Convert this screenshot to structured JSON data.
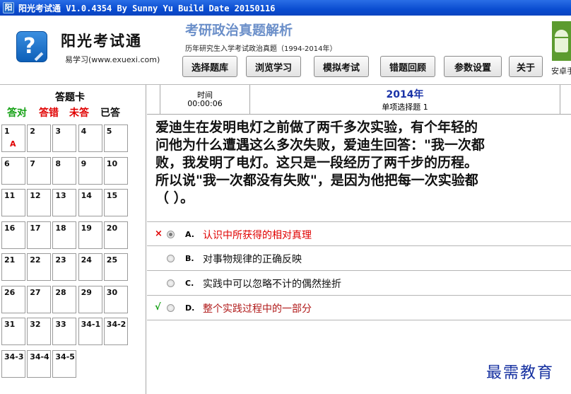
{
  "window": {
    "title": "阳光考试通 V1.0.4354 By Sunny Yu  Build Date 20150116",
    "icon": "阳"
  },
  "header": {
    "app_name": "阳光考试通",
    "app_site": "易学习(www.exuexi.com)",
    "exam_title": "考研政治真题解析",
    "exam_subtitle": "历年研究生入学考试政治真题（1994-2014年）",
    "android_label": "安卓手"
  },
  "nav": [
    "选择题库",
    "浏览学习",
    "模拟考试",
    "错题回顾",
    "参数设置",
    "关于"
  ],
  "answer_card": {
    "title": "答题卡",
    "legend": [
      {
        "label": "答对",
        "color": "#12a012"
      },
      {
        "label": "答错",
        "color": "#e00000"
      },
      {
        "label": "未答",
        "color": "#e00000"
      },
      {
        "label": "已答",
        "color": "#111111"
      }
    ],
    "cells": [
      {
        "n": "1",
        "a": "A"
      },
      {
        "n": "2",
        "a": ""
      },
      {
        "n": "3",
        "a": ""
      },
      {
        "n": "4",
        "a": ""
      },
      {
        "n": "5",
        "a": ""
      },
      {
        "n": "6",
        "a": ""
      },
      {
        "n": "7",
        "a": ""
      },
      {
        "n": "8",
        "a": ""
      },
      {
        "n": "9",
        "a": ""
      },
      {
        "n": "10",
        "a": ""
      },
      {
        "n": "11",
        "a": ""
      },
      {
        "n": "12",
        "a": ""
      },
      {
        "n": "13",
        "a": ""
      },
      {
        "n": "14",
        "a": ""
      },
      {
        "n": "15",
        "a": ""
      },
      {
        "n": "16",
        "a": ""
      },
      {
        "n": "17",
        "a": ""
      },
      {
        "n": "18",
        "a": ""
      },
      {
        "n": "19",
        "a": ""
      },
      {
        "n": "20",
        "a": ""
      },
      {
        "n": "21",
        "a": ""
      },
      {
        "n": "22",
        "a": ""
      },
      {
        "n": "23",
        "a": ""
      },
      {
        "n": "24",
        "a": ""
      },
      {
        "n": "25",
        "a": ""
      },
      {
        "n": "26",
        "a": ""
      },
      {
        "n": "27",
        "a": ""
      },
      {
        "n": "28",
        "a": ""
      },
      {
        "n": "29",
        "a": ""
      },
      {
        "n": "30",
        "a": ""
      },
      {
        "n": "31",
        "a": ""
      },
      {
        "n": "32",
        "a": ""
      },
      {
        "n": "33",
        "a": ""
      },
      {
        "n": "34-1",
        "a": ""
      },
      {
        "n": "34-2",
        "a": ""
      },
      {
        "n": "34-3",
        "a": ""
      },
      {
        "n": "34-4",
        "a": ""
      },
      {
        "n": "34-5",
        "a": ""
      }
    ]
  },
  "question_header": {
    "time_label": "时间",
    "time_value": "00:00:06",
    "year": "2014年",
    "type": "单项选择题 1"
  },
  "question_lines": [
    "爱迪生在发明电灯之前做了两千多次实验，有个年轻的",
    "问他为什么遭遇这么多次失败，爱迪生回答：\"我一次都",
    "败，我发明了电灯。这只是一段经历了两千步的历程。",
    "所以说\"我一次都没有失败\"，是因为他把每一次实验都",
    "（ ）。"
  ],
  "options": [
    {
      "mark": "×",
      "mark_color": "#e00000",
      "letter": "A.",
      "text": "认识中所获得的相对真理",
      "text_color": "#e00000",
      "selected": true
    },
    {
      "mark": "",
      "mark_color": "#000000",
      "letter": "B.",
      "text": "对事物规律的正确反映",
      "text_color": "#111111",
      "selected": false
    },
    {
      "mark": "",
      "mark_color": "#000000",
      "letter": "C.",
      "text": "实践中可以忽略不计的偶然挫折",
      "text_color": "#111111",
      "selected": false
    },
    {
      "mark": "√",
      "mark_color": "#12a012",
      "letter": "D.",
      "text": "整个实践过程中的一部分",
      "text_color": "#b01818",
      "selected": false
    }
  ],
  "watermark": "最需教育"
}
